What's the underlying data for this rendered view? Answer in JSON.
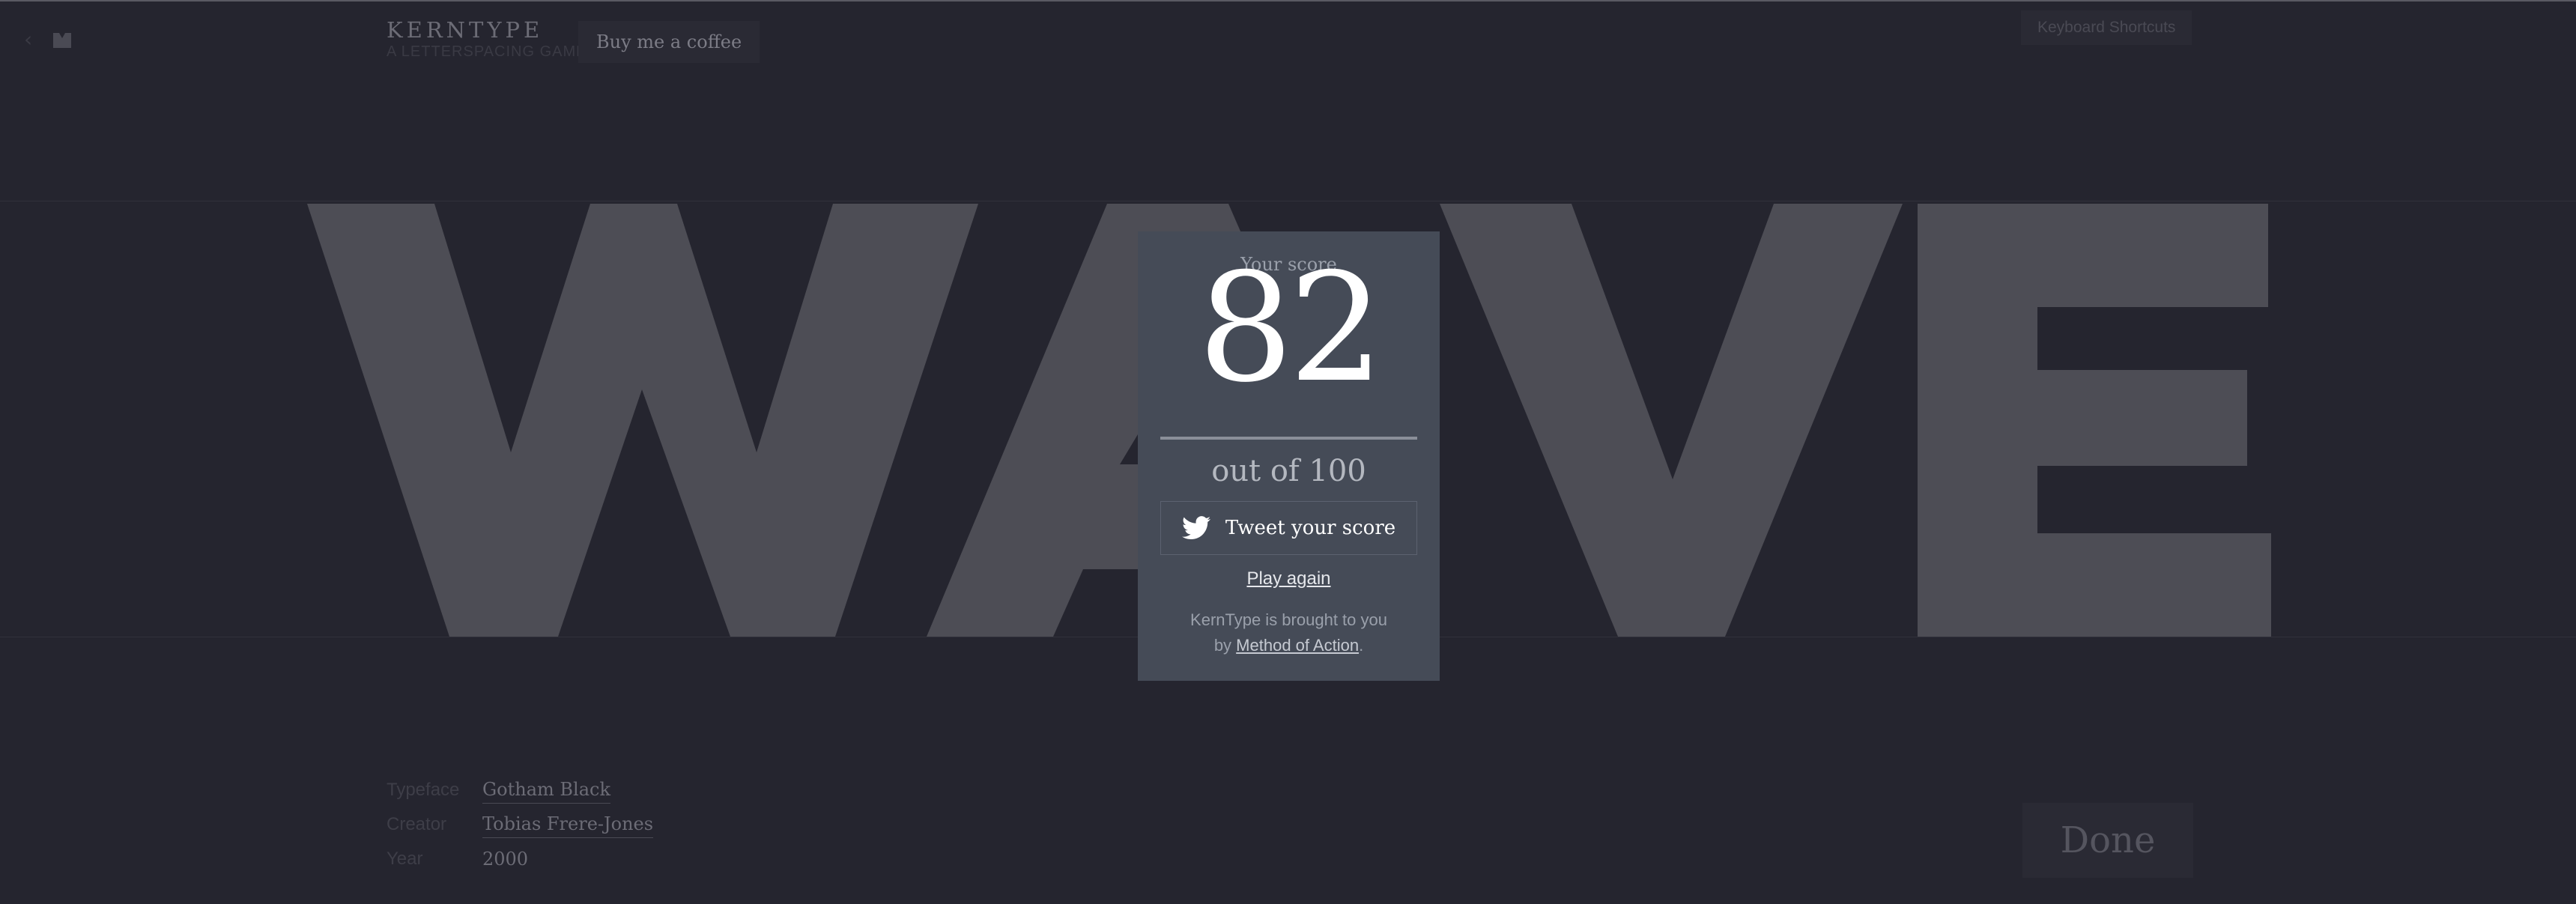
{
  "header": {
    "brand_name": "KERNTYPE",
    "brand_tagline": "A LETTERSPACING GAME",
    "coffee_label": "Buy me a coffee",
    "shortcuts_label": "Keyboard Shortcuts"
  },
  "puzzle": {
    "word": "WAVE",
    "letters": [
      "W",
      "A",
      "V",
      "E"
    ]
  },
  "modal": {
    "score_label": "Your score",
    "score": "82",
    "out_of": "out of 100",
    "tweet_label": "Tweet your score",
    "play_again": "Play again",
    "credit_prefix": "KernType is brought to you by ",
    "credit_link": "Method of Action",
    "credit_suffix": "."
  },
  "info": {
    "typeface_label": "Typeface",
    "typeface_value": "Gotham Black",
    "creator_label": "Creator",
    "creator_value": "Tobias Frere-Jones",
    "year_label": "Year",
    "year_value": "2000"
  },
  "done_label": "Done",
  "colors": {
    "background": "#25252f",
    "letters": "#4d4d55",
    "modal": "#454b57",
    "accent_text": "#ffffff"
  },
  "icons": [
    "back-arrow-icon",
    "kerntype-logo-icon",
    "twitter-bird-icon"
  ]
}
